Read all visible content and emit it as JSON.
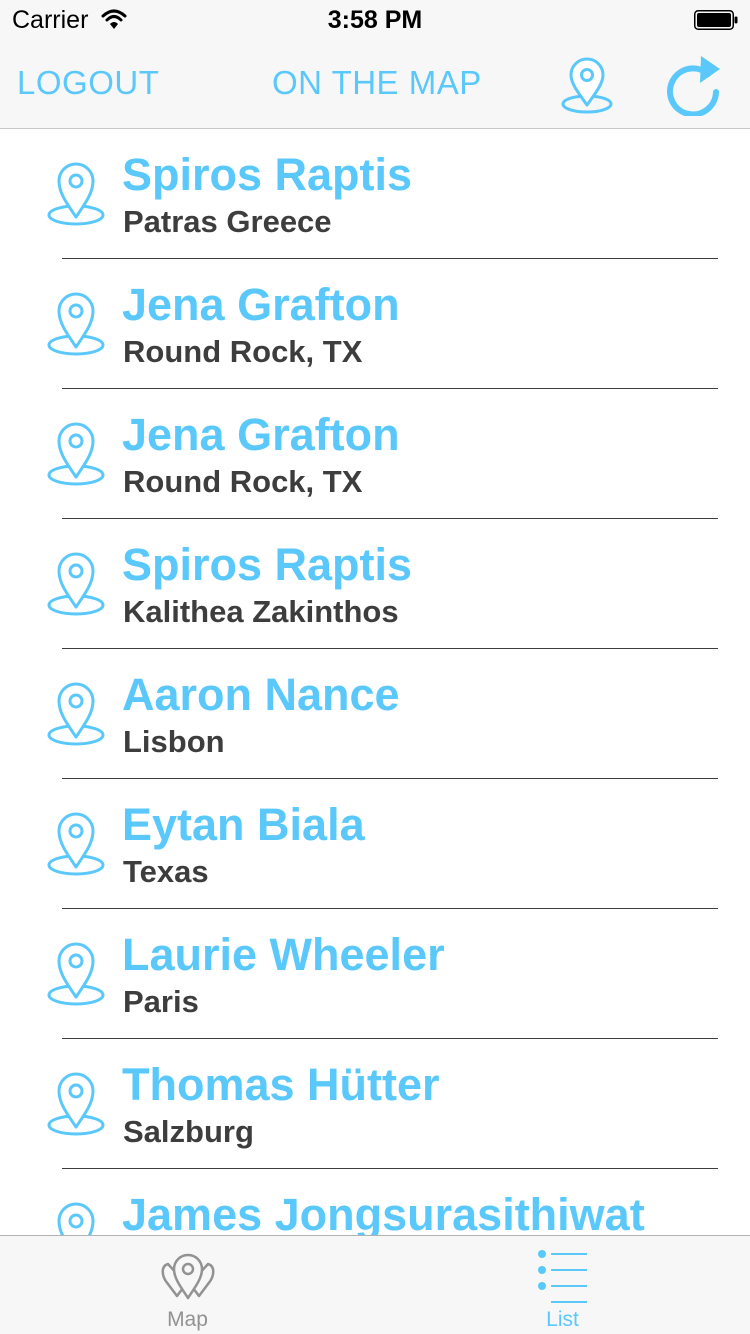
{
  "status_bar": {
    "carrier": "Carrier",
    "time": "3:58 PM"
  },
  "nav": {
    "logout_label": "LOGOUT",
    "title": "ON THE MAP",
    "right_icons": [
      "map-pin-icon",
      "refresh-icon"
    ]
  },
  "colors": {
    "accent": "#5ac8fa",
    "subtitle_text": "#3d3d3d",
    "inactive_tab": "#929292",
    "bar_background": "#f7f7f7"
  },
  "students": [
    {
      "name": "Spiros Raptis",
      "location": "Patras Greece"
    },
    {
      "name": "Jena Grafton",
      "location": "Round Rock, TX"
    },
    {
      "name": "Jena Grafton",
      "location": "Round Rock, TX"
    },
    {
      "name": "Spiros Raptis",
      "location": "Kalithea Zakinthos"
    },
    {
      "name": "Aaron Nance",
      "location": "Lisbon"
    },
    {
      "name": "Eytan Biala",
      "location": "Texas"
    },
    {
      "name": "Laurie Wheeler",
      "location": "Paris"
    },
    {
      "name": "Thomas Hütter",
      "location": "Salzburg"
    },
    {
      "name": "James Jongsurasithiwat",
      "location": ""
    }
  ],
  "tabs": [
    {
      "label": "Map",
      "icon": "map-icon",
      "selected": false
    },
    {
      "label": "List",
      "icon": "list-icon",
      "selected": true
    }
  ]
}
